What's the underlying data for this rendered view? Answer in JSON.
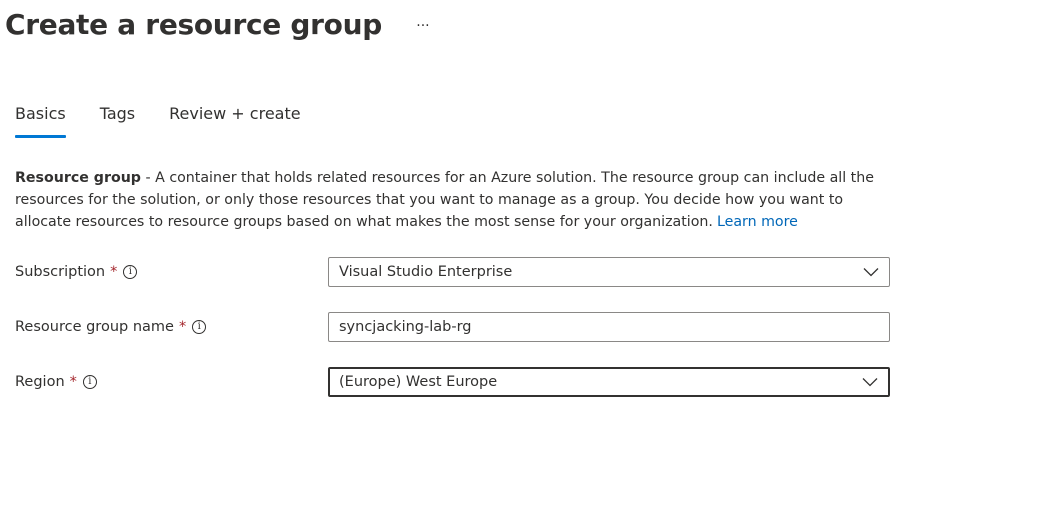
{
  "header": {
    "title": "Create a resource group",
    "more_label": "···"
  },
  "tabs": [
    {
      "label": "Basics",
      "active": true
    },
    {
      "label": "Tags",
      "active": false
    },
    {
      "label": "Review + create",
      "active": false
    }
  ],
  "description": {
    "bold": "Resource group",
    "text": " - A container that holds related resources for an Azure solution. The resource group can include all the resources for the solution, or only those resources that you want to manage as a group. You decide how you want to allocate resources to resource groups based on what makes the most sense for your organization.",
    "link": "Learn more"
  },
  "form": {
    "subscription": {
      "label": "Subscription",
      "required": "*",
      "info": "i",
      "value": "Visual Studio Enterprise"
    },
    "resource_group_name": {
      "label": "Resource group name",
      "required": "*",
      "info": "i",
      "value": "syncjacking-lab-rg"
    },
    "region": {
      "label": "Region",
      "required": "*",
      "info": "i",
      "value": "(Europe) West Europe"
    }
  },
  "colors": {
    "accent": "#0078d4",
    "link": "#0067b8",
    "required": "#a4262c",
    "text": "#323130",
    "border": "#8a8886"
  },
  "icons": {
    "more": "more-horizontal-icon",
    "info": "info-icon",
    "dropdown": "chevron-down-icon"
  }
}
